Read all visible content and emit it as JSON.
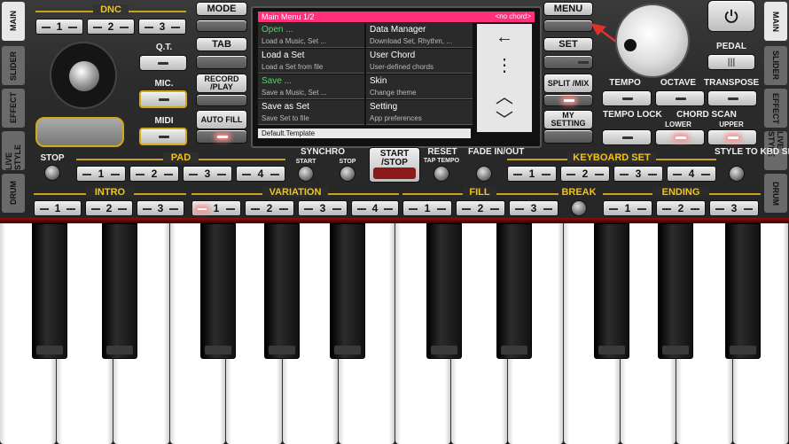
{
  "side_tabs_left": [
    "MAIN",
    "SLIDER",
    "EFFECT",
    "LIVE STYLE",
    "DRUM"
  ],
  "side_tabs_right": [
    "MAIN",
    "SLIDER",
    "EFFECT",
    "LIVE STYLE",
    "DRUM"
  ],
  "dnc": {
    "label": "DNC",
    "buttons": [
      "1",
      "2",
      "3"
    ]
  },
  "left_buttons": {
    "qt": "Q.T.",
    "mic": "MIC.",
    "midi": "MIDI"
  },
  "center_left_buttons": {
    "mode": "MODE",
    "tab": "TAB",
    "record": "RECORD /PLAY",
    "auto_fill": "AUTO FILL"
  },
  "screen": {
    "header": "Main Menu  1/2",
    "chord": "<no chord>",
    "items": [
      {
        "title": "Open ...",
        "sub": "Load a Music, Set ..."
      },
      {
        "title": "Data Manager",
        "sub": "Download Set, Rhythm, ..."
      },
      {
        "title": "Load a Set",
        "sub": "Load a Set from file"
      },
      {
        "title": "User Chord",
        "sub": "User-defined chords"
      },
      {
        "title": "Save ...",
        "sub": "Save a Music, Set ..."
      },
      {
        "title": "Skin",
        "sub": "Change theme"
      },
      {
        "title": "Save as Set",
        "sub": "Save Set to file"
      },
      {
        "title": "Setting",
        "sub": "App preferences"
      }
    ],
    "footer": "Default.Template",
    "nav": [
      "←",
      "⋮",
      "︿",
      "﹀"
    ]
  },
  "right_center_buttons": {
    "menu": "MENU",
    "set": "SET",
    "split_mix": "SPLIT /MIX",
    "my_setting": "MY SETTING"
  },
  "right_controls": {
    "pedal": "PEDAL",
    "tempo": "TEMPO",
    "octave": "OCTAVE",
    "transpose": "TRANSPOSE",
    "tempo_lock": "TEMPO LOCK",
    "chord_scan": "CHORD SCAN",
    "lower": "LOWER",
    "upper": "UPPER"
  },
  "row2": {
    "stop": "STOP",
    "pad": "PAD",
    "pad_buttons": [
      "1",
      "2",
      "3",
      "4"
    ],
    "synchro": "SYNCHRO",
    "sync_start": "START",
    "sync_stop": "STOP",
    "start_stop": "START /STOP",
    "reset": "RESET",
    "tap_tempo": "TAP TEMPO",
    "fade": "FADE IN/OUT",
    "keyboard_set": "KEYBOARD SET",
    "kbd_buttons": [
      "1",
      "2",
      "3",
      "4"
    ],
    "style_to": "STYLE TO KBD SET"
  },
  "row3": {
    "intro": "INTRO",
    "intro_buttons": [
      "1",
      "2",
      "3"
    ],
    "variation": "VARIATION",
    "var_buttons": [
      "1",
      "2",
      "3",
      "4"
    ],
    "fill": "FILL",
    "fill_buttons": [
      "1",
      "2",
      "3"
    ],
    "break": "BREAK",
    "ending": "ENDING",
    "end_buttons": [
      "1",
      "2",
      "3"
    ]
  }
}
